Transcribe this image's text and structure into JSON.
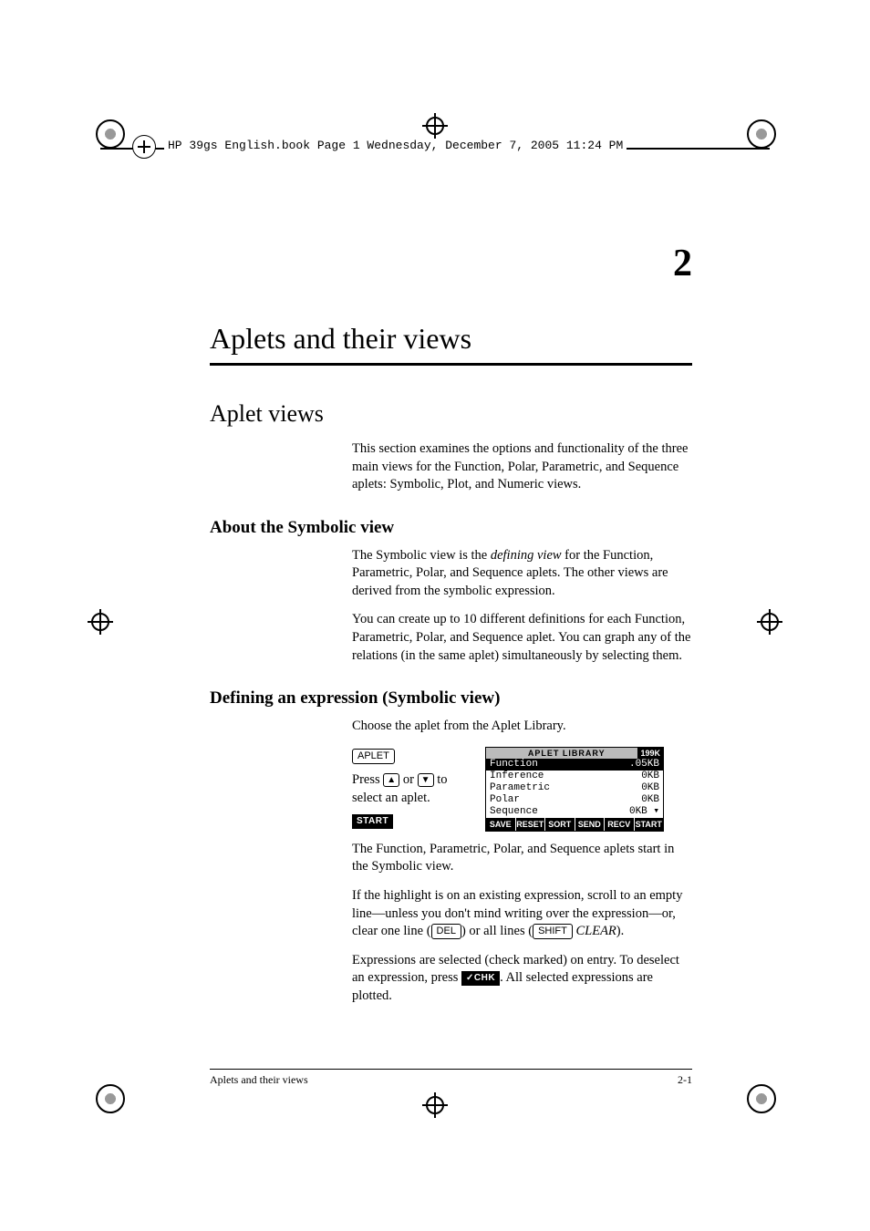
{
  "headerLine": "HP 39gs English.book  Page 1  Wednesday, December 7, 2005  11:24 PM",
  "chapterNum": "2",
  "chapterTitle": "Aplets and their views",
  "h1": "Aplet views",
  "introP": "This section examines the options and functionality of the three main views for the Function, Polar, Parametric, and Sequence aplets: Symbolic, Plot, and Numeric views.",
  "h2a": "About the Symbolic view",
  "symP1a": "The Symbolic view is the ",
  "symP1italic": "defining view",
  "symP1b": " for the Function, Parametric, Polar, and Sequence aplets. The other views are derived from the symbolic expression.",
  "symP2": "You can create up to 10 different definitions for each Function, Parametric, Polar, and Sequence aplet. You can graph any of the relations (in the same aplet) simultaneously by selecting them.",
  "h2b": "Defining an expression (Symbolic view)",
  "defP1": "Choose the aplet from the Aplet Library.",
  "keyAplet": "APLET",
  "leftColA": "Press ",
  "leftColB": " or ",
  "leftColC": " to select an aplet.",
  "keyStart": "START",
  "calc": {
    "title": "APLET LIBRARY",
    "mem": "199K",
    "rows": [
      {
        "name": "Function",
        "size": ".05KB",
        "sel": true
      },
      {
        "name": "Inference",
        "size": "0KB",
        "sel": false
      },
      {
        "name": "Parametric",
        "size": "0KB",
        "sel": false
      },
      {
        "name": "Polar",
        "size": "0KB",
        "sel": false
      },
      {
        "name": "Sequence",
        "size": "0KB ▾",
        "sel": false
      }
    ],
    "menu": [
      "SAVE",
      "RESET",
      "SORT",
      "SEND",
      "RECV",
      "START"
    ]
  },
  "defP2": "The Function, Parametric, Polar, and Sequence aplets start in the Symbolic view.",
  "defP3a": "If the highlight is on an existing expression, scroll to an empty line—unless you don't mind writing over the expression—or, clear one line (",
  "keyDel": "DEL",
  "defP3b": ") or all lines (",
  "keyShift": "SHIFT",
  "keyClear": "CLEAR",
  "defP3c": ").",
  "defP4a": "Expressions are selected (check marked) on entry. To deselect an expression, press ",
  "keyChk": "✓CHK",
  "defP4b": ". All selected expressions are plotted.",
  "footerLeft": "Aplets and their views",
  "footerRight": "2-1"
}
